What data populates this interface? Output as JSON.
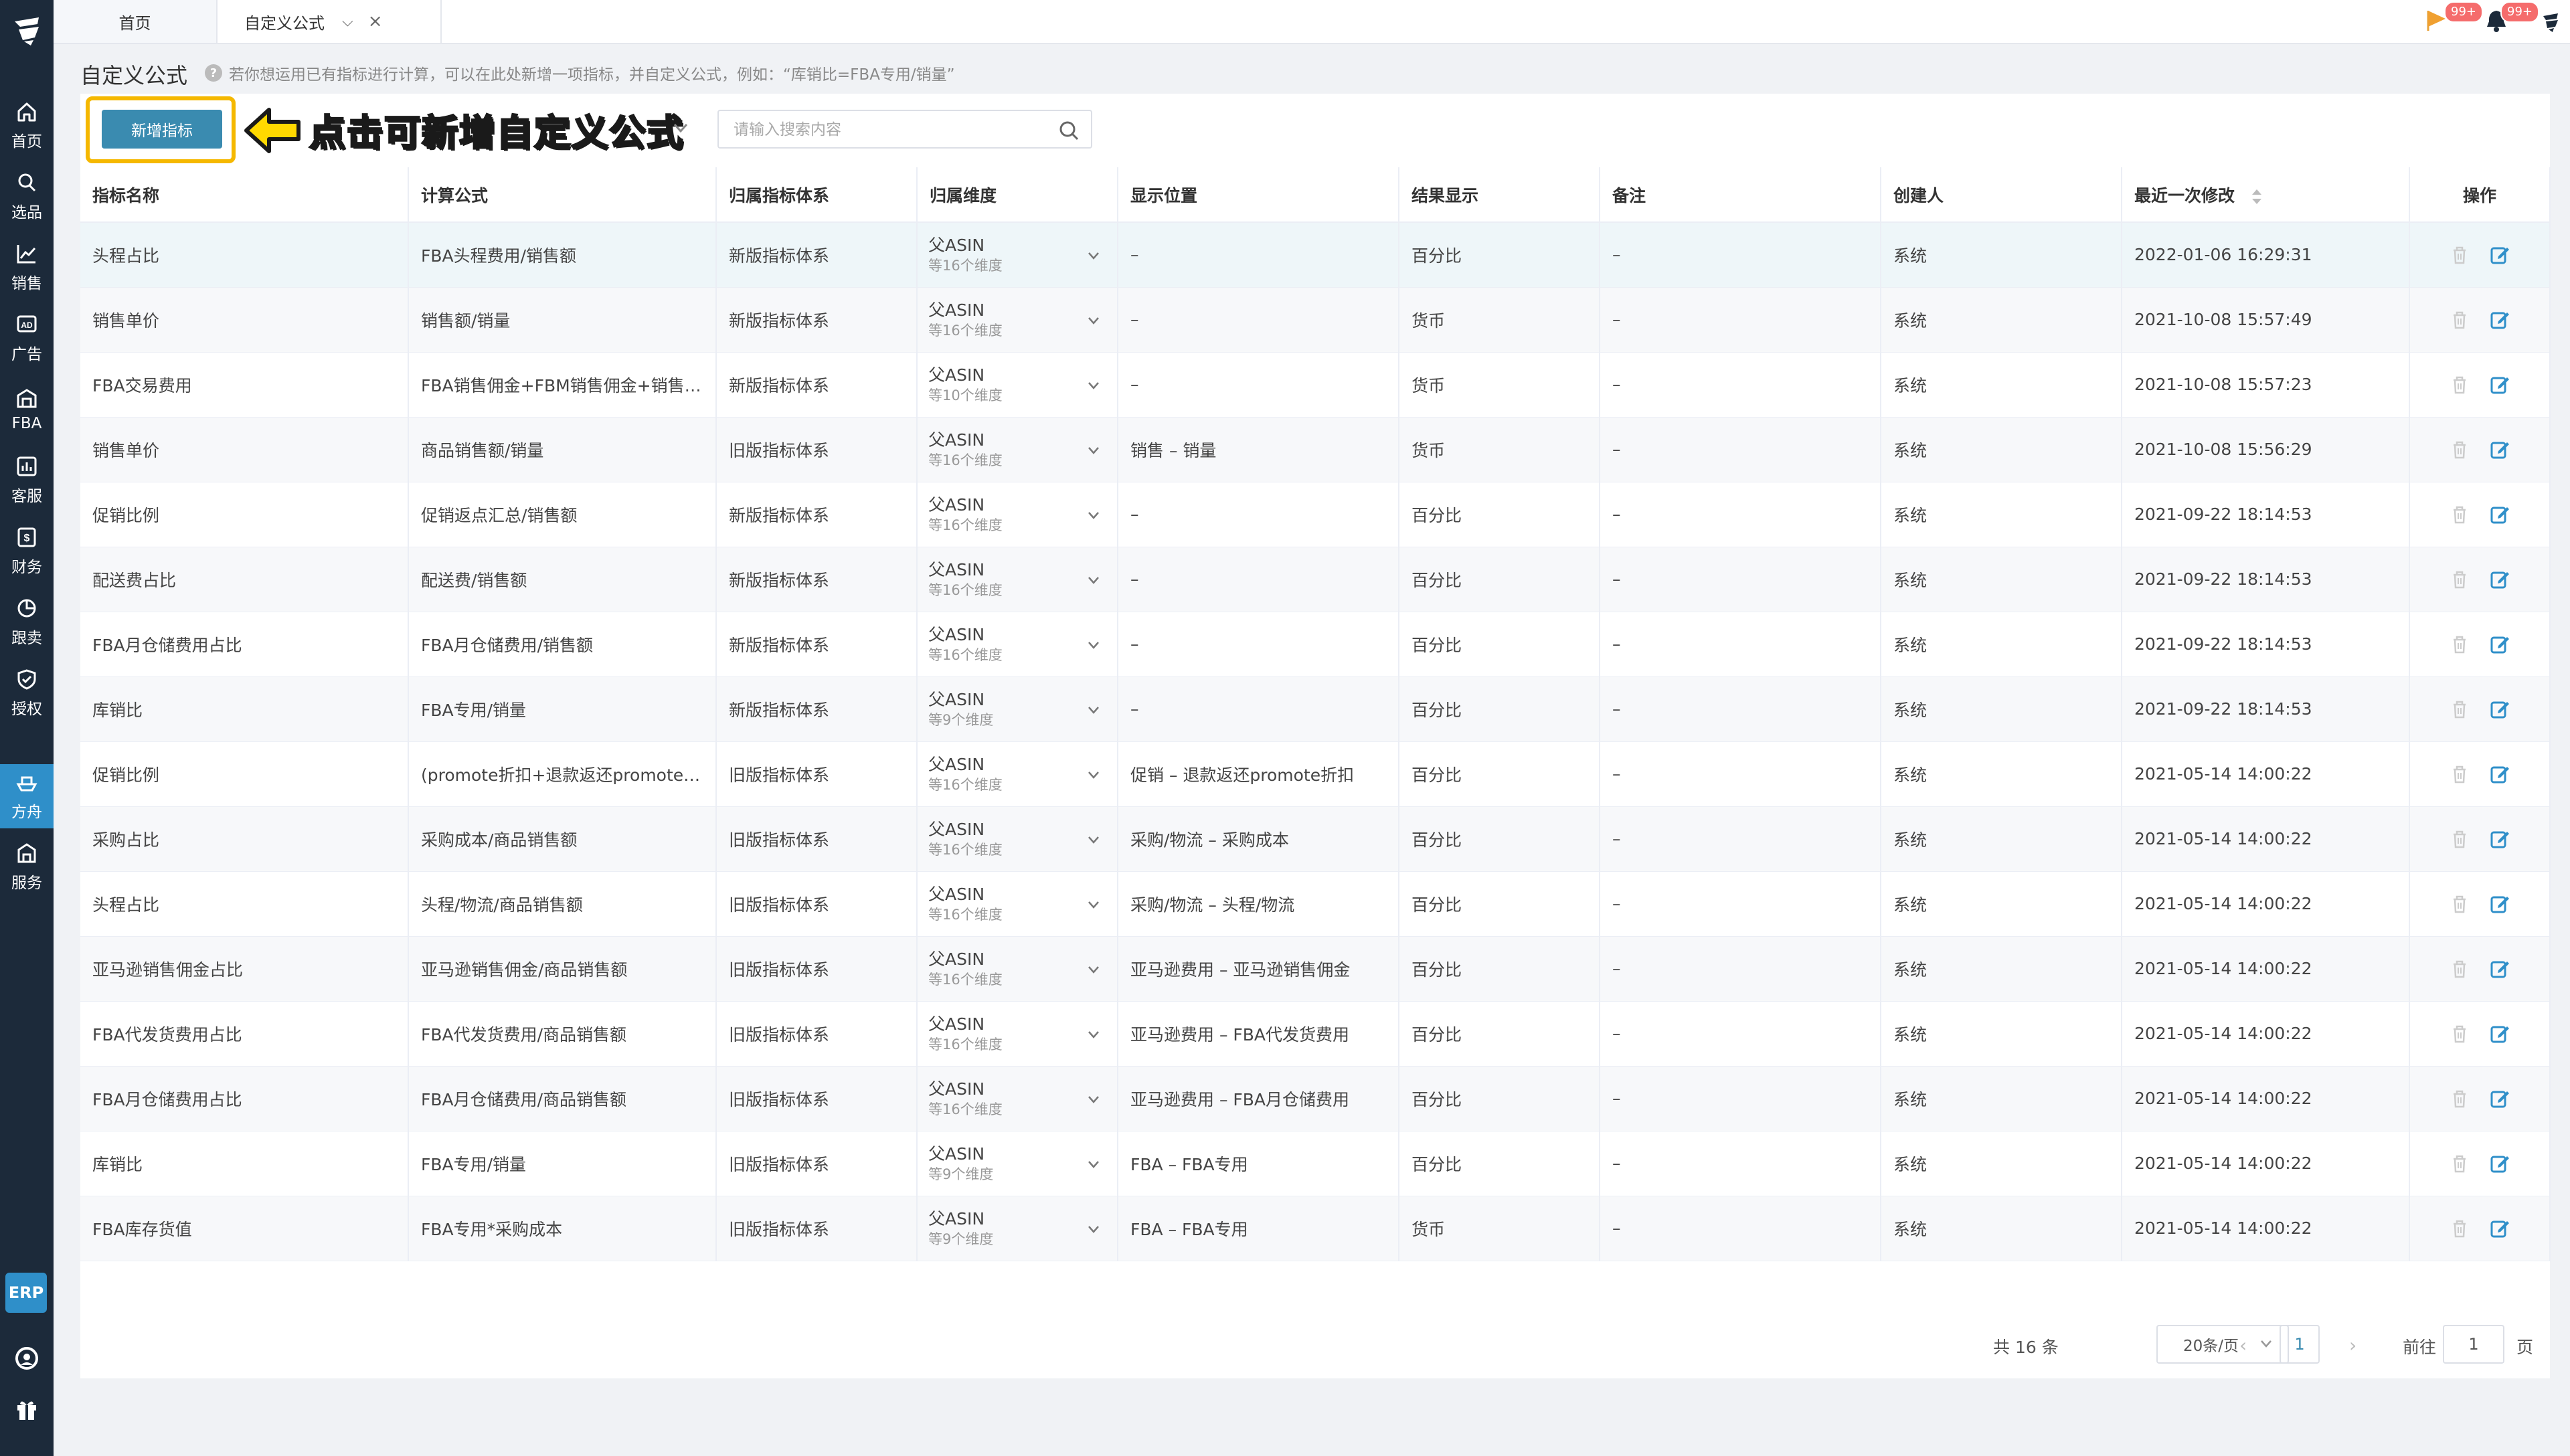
{
  "sidebar": {
    "items": [
      {
        "label": "首页",
        "icon": "home-icon"
      },
      {
        "label": "选品",
        "icon": "search-icon"
      },
      {
        "label": "销售",
        "icon": "chart-line-icon"
      },
      {
        "label": "广告",
        "icon": "ad-icon"
      },
      {
        "label": "FBA",
        "icon": "warehouse-icon"
      },
      {
        "label": "客服",
        "icon": "bar-chart-icon"
      },
      {
        "label": "财务",
        "icon": "dollar-icon"
      },
      {
        "label": "跟卖",
        "icon": "pie-chart-icon"
      },
      {
        "label": "授权",
        "icon": "shield-icon"
      },
      {
        "label": "方舟",
        "icon": "ark-icon"
      },
      {
        "label": "服务",
        "icon": "store-icon"
      }
    ],
    "active": "方舟",
    "erp_label": "ERP"
  },
  "tabs": {
    "home": "首页",
    "current": "自定义公式"
  },
  "topbar": {
    "badge_flag": "99+",
    "badge_bell": "99+"
  },
  "page": {
    "title": "自定义公式",
    "tip": "若你想运用已有指标进行计算，可以在此处新增一项指标，并自定义公式，例如：“库销比=FBA专用/销量”"
  },
  "toolbar": {
    "add_button": "新增指标",
    "annotation": "点击可新增自定义公式",
    "search_placeholder": "请输入搜索内容"
  },
  "table": {
    "headers": [
      "指标名称",
      "计算公式",
      "归属指标体系",
      "归属维度",
      "显示位置",
      "结果显示",
      "备注",
      "创建人",
      "最近一次修改",
      "操作"
    ],
    "rows": [
      {
        "name": "头程占比",
        "formula": "FBA头程费用/销售额",
        "system": "新版指标体系",
        "dim": "父ASIN",
        "dim_sub": "等16个维度",
        "position": "–",
        "result": "百分比",
        "note": "–",
        "creator": "系统",
        "modified": "2022-01-06 16:29:31"
      },
      {
        "name": "销售单价",
        "formula": "销售额/销量",
        "system": "新版指标体系",
        "dim": "父ASIN",
        "dim_sub": "等16个维度",
        "position": "–",
        "result": "货币",
        "note": "–",
        "creator": "系统",
        "modified": "2021-10-08 15:57:49"
      },
      {
        "name": "FBA交易费用",
        "formula": "FBA销售佣金+FBM销售佣金+销售佣金",
        "system": "新版指标体系",
        "dim": "父ASIN",
        "dim_sub": "等10个维度",
        "position": "–",
        "result": "货币",
        "note": "–",
        "creator": "系统",
        "modified": "2021-10-08 15:57:23"
      },
      {
        "name": "销售单价",
        "formula": "商品销售额/销量",
        "system": "旧版指标体系",
        "dim": "父ASIN",
        "dim_sub": "等16个维度",
        "position": "销售 – 销量",
        "result": "货币",
        "note": "–",
        "creator": "系统",
        "modified": "2021-10-08 15:56:29"
      },
      {
        "name": "促销比例",
        "formula": "促销返点汇总/销售额",
        "system": "新版指标体系",
        "dim": "父ASIN",
        "dim_sub": "等16个维度",
        "position": "–",
        "result": "百分比",
        "note": "–",
        "creator": "系统",
        "modified": "2021-09-22 18:14:53"
      },
      {
        "name": "配送费占比",
        "formula": "配送费/销售额",
        "system": "新版指标体系",
        "dim": "父ASIN",
        "dim_sub": "等16个维度",
        "position": "–",
        "result": "百分比",
        "note": "–",
        "creator": "系统",
        "modified": "2021-09-22 18:14:53"
      },
      {
        "name": "FBA月仓储费用占比",
        "formula": "FBA月仓储费用/销售额",
        "system": "新版指标体系",
        "dim": "父ASIN",
        "dim_sub": "等16个维度",
        "position": "–",
        "result": "百分比",
        "note": "–",
        "creator": "系统",
        "modified": "2021-09-22 18:14:53"
      },
      {
        "name": "库销比",
        "formula": "FBA专用/销量",
        "system": "新版指标体系",
        "dim": "父ASIN",
        "dim_sub": "等9个维度",
        "position": "–",
        "result": "百分比",
        "note": "–",
        "creator": "系统",
        "modified": "2021-09-22 18:14:53"
      },
      {
        "name": "促销比例",
        "formula": "(promote折扣+退款返还promote折扣)",
        "system": "旧版指标体系",
        "dim": "父ASIN",
        "dim_sub": "等16个维度",
        "position": "促销 – 退款返还promote折扣",
        "result": "百分比",
        "note": "–",
        "creator": "系统",
        "modified": "2021-05-14 14:00:22"
      },
      {
        "name": "采购占比",
        "formula": "采购成本/商品销售额",
        "system": "旧版指标体系",
        "dim": "父ASIN",
        "dim_sub": "等16个维度",
        "position": "采购/物流 – 采购成本",
        "result": "百分比",
        "note": "–",
        "creator": "系统",
        "modified": "2021-05-14 14:00:22"
      },
      {
        "name": "头程占比",
        "formula": "头程/物流/商品销售额",
        "system": "旧版指标体系",
        "dim": "父ASIN",
        "dim_sub": "等16个维度",
        "position": "采购/物流 – 头程/物流",
        "result": "百分比",
        "note": "–",
        "creator": "系统",
        "modified": "2021-05-14 14:00:22"
      },
      {
        "name": "亚马逊销售佣金占比",
        "formula": "亚马逊销售佣金/商品销售额",
        "system": "旧版指标体系",
        "dim": "父ASIN",
        "dim_sub": "等16个维度",
        "position": "亚马逊费用 – 亚马逊销售佣金",
        "result": "百分比",
        "note": "–",
        "creator": "系统",
        "modified": "2021-05-14 14:00:22"
      },
      {
        "name": "FBA代发货费用占比",
        "formula": "FBA代发货费用/商品销售额",
        "system": "旧版指标体系",
        "dim": "父ASIN",
        "dim_sub": "等16个维度",
        "position": "亚马逊费用 – FBA代发货费用",
        "result": "百分比",
        "note": "–",
        "creator": "系统",
        "modified": "2021-05-14 14:00:22"
      },
      {
        "name": "FBA月仓储费用占比",
        "formula": "FBA月仓储费用/商品销售额",
        "system": "旧版指标体系",
        "dim": "父ASIN",
        "dim_sub": "等16个维度",
        "position": "亚马逊费用 – FBA月仓储费用",
        "result": "百分比",
        "note": "–",
        "creator": "系统",
        "modified": "2021-05-14 14:00:22"
      },
      {
        "name": "库销比",
        "formula": "FBA专用/销量",
        "system": "旧版指标体系",
        "dim": "父ASIN",
        "dim_sub": "等9个维度",
        "position": "FBA – FBA专用",
        "result": "百分比",
        "note": "–",
        "creator": "系统",
        "modified": "2021-05-14 14:00:22"
      },
      {
        "name": "FBA库存货值",
        "formula": "FBA专用*采购成本",
        "system": "旧版指标体系",
        "dim": "父ASIN",
        "dim_sub": "等9个维度",
        "position": "FBA – FBA专用",
        "result": "货币",
        "note": "–",
        "creator": "系统",
        "modified": "2021-05-14 14:00:22"
      }
    ]
  },
  "pagination": {
    "total": "共 16 条",
    "page_size": "20条/页",
    "current": "1",
    "goto_label": "前往",
    "goto_value": "1",
    "page_label": "页"
  },
  "colors": {
    "sidebar_bg": "#1c2a3a",
    "accent": "#3a8bb0",
    "highlight": "#f5b800",
    "annotation": "#ffd900"
  }
}
